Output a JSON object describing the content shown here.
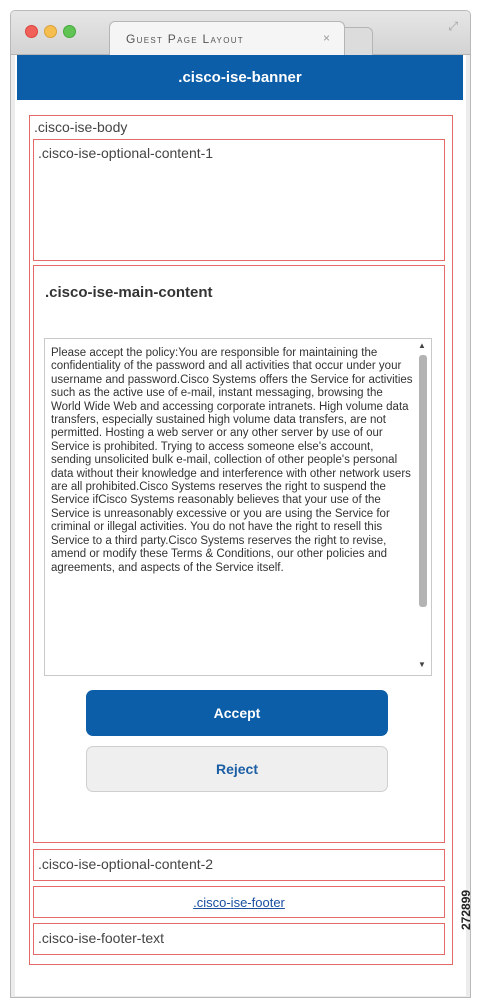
{
  "window": {
    "tab_title": "Guest Page Layout",
    "tab_close": "×"
  },
  "banner": {
    "label": ".cisco-ise-banner"
  },
  "body": {
    "label": ".cisco-ise-body"
  },
  "optional_content_1": {
    "label": ".cisco-ise-optional-content-1"
  },
  "main_content": {
    "label": ".cisco-ise-main-content",
    "policy_text": "Please accept the policy:You are responsible for maintaining the confidentiality of the password and all activities that occur under your username and password.Cisco Systems offers the Service for activities such as the active use of e-mail, instant messaging, browsing the World Wide Web and accessing corporate intranets. High volume data transfers, especially sustained high volume data transfers, are not permitted. Hosting a web server or any other server by use of our Service is prohibited. Trying to access someone else's account, sending unsolicited bulk e-mail, collection of other people's personal data without their knowledge and interference with other network users are all prohibited.Cisco Systems reserves the right to suspend the Service ifCisco Systems reasonably believes that your use of the Service is unreasonably excessive or you are using the Service for criminal or illegal activities. You do not have the right to resell this Service to a third party.Cisco Systems reserves the right to revise, amend or modify these Terms & Conditions, our other policies and agreements, and aspects of the Service itself.",
    "accept_label": "Accept",
    "reject_label": "Reject"
  },
  "optional_content_2": {
    "label": ".cisco-ise-optional-content-2"
  },
  "footer": {
    "label": ".cisco-ise-footer"
  },
  "footer_text": {
    "label": ".cisco-ise-footer-text"
  },
  "figure_id": "272899",
  "colors": {
    "banner": "#0d5ea8",
    "accept_button": "#0d5ea8",
    "region_border": "#e46a6a"
  },
  "icons": {
    "close": "close-icon",
    "resize": "resize-icon",
    "scroll_up": "chevron-up-icon",
    "scroll_down": "chevron-down-icon"
  }
}
